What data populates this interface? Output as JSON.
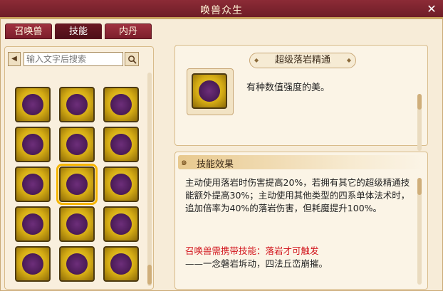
{
  "window": {
    "title": "唤兽众生",
    "close_glyph": "✕"
  },
  "tabs": [
    {
      "label": "召唤兽"
    },
    {
      "label": "技能"
    },
    {
      "label": "内丹"
    }
  ],
  "search": {
    "placeholder": "输入文字后搜索",
    "prev_glyph": "◀"
  },
  "skill_icons": [
    "sword-skill-icon",
    "lightning-skill-icon",
    "figure-skill-icon",
    "swirl-skill-icon",
    "burst-skill-icon",
    "storm-skill-icon",
    "rock-skill-icon",
    "fist-skill-icon",
    "claw-skill-icon",
    "crack-skill-icon",
    "wave-skill-icon",
    "chain-skill-icon",
    "stairs-skill-icon",
    "hourglass-skill-icon",
    "axe-skill-icon"
  ],
  "selected_skill": {
    "name": "超级落岩精通",
    "short_desc": "有种数值强度的美。"
  },
  "effect": {
    "header": "技能效果",
    "text": "主动使用落岩时伤害提高20%，若拥有其它的超级精通技能额外提高30%；主动使用其他类型的四系单体法术时，追加倍率为40%的落岩伤害，但耗魔提升100%。",
    "requirement": "召唤兽需携带技能：落岩才可触发",
    "flavor": "——一念磐岩坼动，四法丘峦崩摧。"
  }
}
